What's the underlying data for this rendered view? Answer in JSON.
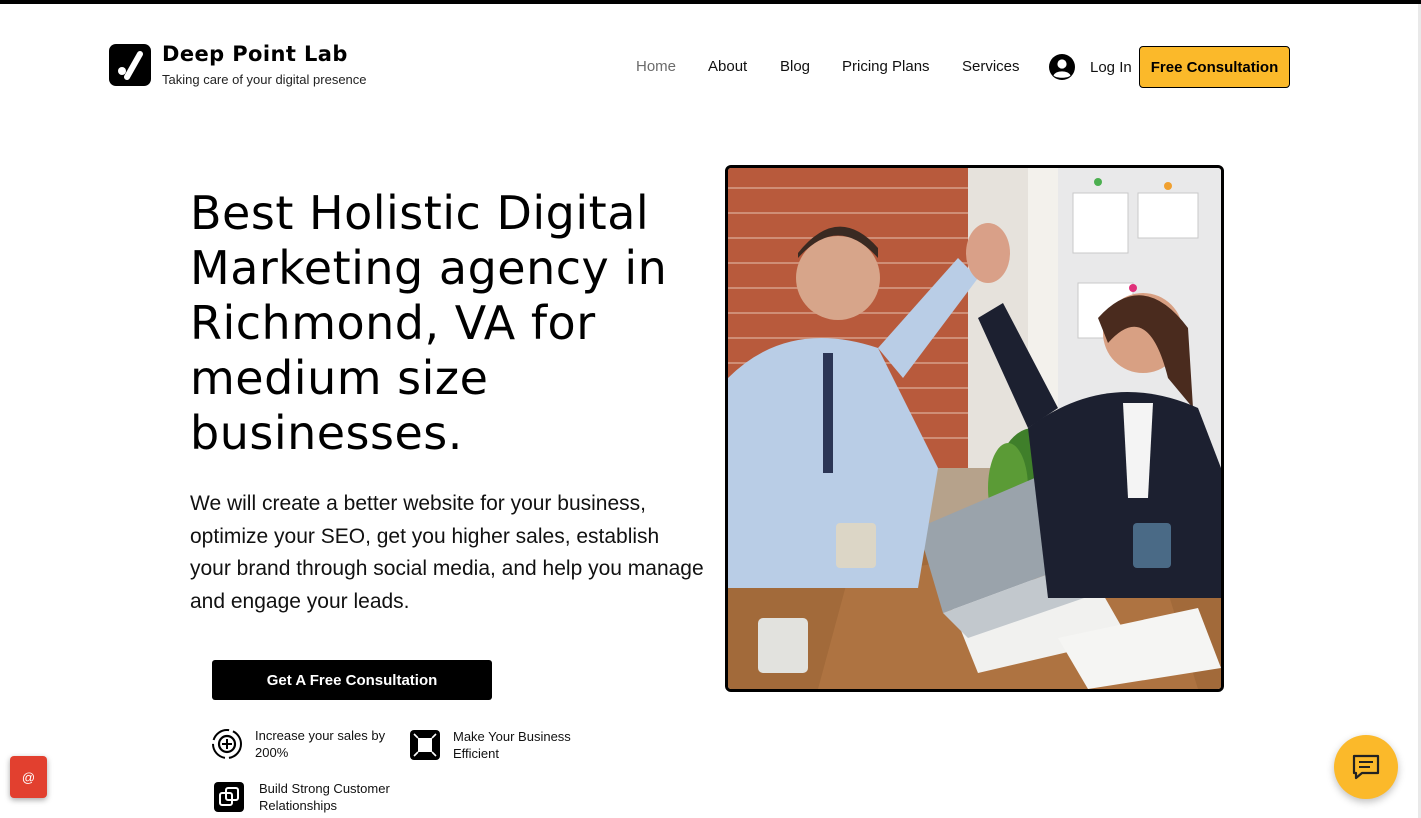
{
  "brand": {
    "name": "Deep Point Lab",
    "tagline": "Taking care of your digital presence",
    "logo_icon": "checkmark-dot-logo-icon"
  },
  "nav": {
    "items": [
      {
        "label": "Home",
        "active": true
      },
      {
        "label": "About",
        "active": false
      },
      {
        "label": "Blog",
        "active": false
      },
      {
        "label": "Pricing Plans",
        "active": false
      },
      {
        "label": "Services",
        "active": false
      }
    ],
    "login_label": "Log In",
    "cta_label": "Free Consultation"
  },
  "hero": {
    "title": "Best Holistic Digital Marketing agency in Richmond, VA for medium size businesses.",
    "description": "We will create a better website for your business, optimize your SEO, get you higher sales, establish your brand through social media, and help you manage and engage your leads.",
    "cta_label": "Get A Free Consultation",
    "image_alt": "Two colleagues giving a high five at an office desk with a laptop"
  },
  "features": [
    {
      "label": "Increase your sales by 200%",
      "icon": "sales-growth-icon"
    },
    {
      "label": "Make Your Business Efficient",
      "icon": "efficiency-icon"
    },
    {
      "label": "Build Strong Customer Relationships",
      "icon": "relationships-icon"
    }
  ],
  "widgets": {
    "email_label": "@",
    "chat_icon": "chat-icon"
  },
  "colors": {
    "accent": "#fbb92a",
    "email_badge": "#e2402f",
    "text": "#000000",
    "nav_active": "#6b6b6b"
  }
}
